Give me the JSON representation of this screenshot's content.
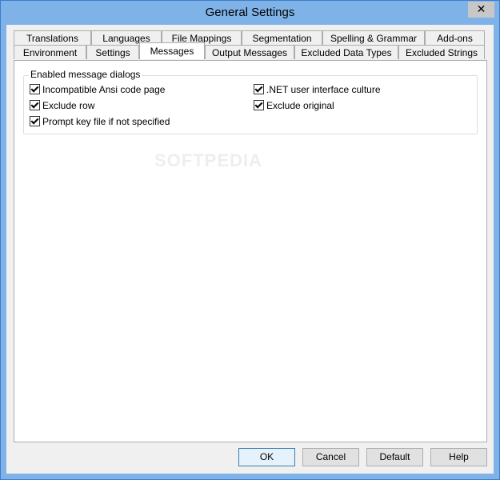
{
  "window": {
    "title": "General Settings",
    "close_glyph": "✕"
  },
  "tabs_row1": [
    "Translations",
    "Languages",
    "File Mappings",
    "Segmentation",
    "Spelling & Grammar",
    "Add-ons"
  ],
  "tabs_row2": [
    "Environment",
    "Settings",
    "Messages",
    "Output Messages",
    "Excluded Data Types",
    "Excluded Strings"
  ],
  "active_tab": "Messages",
  "group": {
    "label": "Enabled message dialogs",
    "options": [
      {
        "label": "Incompatible Ansi code page",
        "checked": true
      },
      {
        "label": "Exclude row",
        "checked": true
      },
      {
        "label": "Prompt key file if not specified",
        "checked": true
      },
      {
        "label": ".NET user interface culture",
        "checked": true
      },
      {
        "label": "Exclude original",
        "checked": true
      }
    ]
  },
  "watermark": "SOFTPEDIA",
  "buttons": {
    "ok": "OK",
    "cancel": "Cancel",
    "default": "Default",
    "help": "Help"
  }
}
